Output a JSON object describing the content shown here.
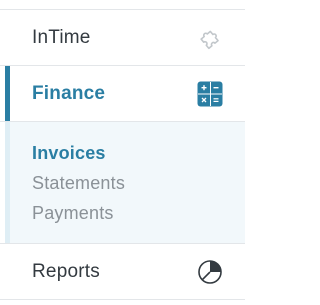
{
  "nav": {
    "items": [
      {
        "label": "InTime",
        "icon": "puzzle-icon"
      },
      {
        "label": "Finance",
        "icon": "calculator-icon",
        "active": true
      },
      {
        "label": "Reports",
        "icon": "pie-chart-icon"
      }
    ],
    "finance_submenu": [
      {
        "label": "Invoices",
        "active": true
      },
      {
        "label": "Statements"
      },
      {
        "label": "Payments"
      }
    ]
  },
  "colors": {
    "accent": "#2a7ea3",
    "text": "#333a40",
    "muted": "#8a9197",
    "submenu_bg": "#f2f8fb",
    "divider": "#e3e6e9"
  }
}
